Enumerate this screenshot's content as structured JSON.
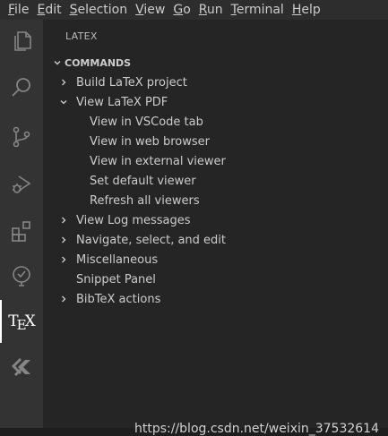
{
  "menubar": {
    "items": [
      {
        "mnemonic": "F",
        "rest": "ile"
      },
      {
        "mnemonic": "E",
        "rest": "dit"
      },
      {
        "mnemonic": "S",
        "rest": "election"
      },
      {
        "mnemonic": "V",
        "rest": "iew"
      },
      {
        "mnemonic": "G",
        "rest": "o"
      },
      {
        "mnemonic": "R",
        "rest": "un"
      },
      {
        "mnemonic": "T",
        "rest": "erminal"
      },
      {
        "mnemonic": "H",
        "rest": "elp"
      }
    ]
  },
  "activitybar": {
    "items": [
      {
        "icon": "files-icon",
        "active": false
      },
      {
        "icon": "search-icon",
        "active": false
      },
      {
        "icon": "source-control-icon",
        "active": false
      },
      {
        "icon": "run-debug-icon",
        "active": false
      },
      {
        "icon": "extensions-icon",
        "active": false
      },
      {
        "icon": "test-icon",
        "active": false
      },
      {
        "icon": "tex-icon",
        "active": true,
        "label_t": "T",
        "label_e": "E",
        "label_x": "X"
      },
      {
        "icon": "remote-icon",
        "active": false
      }
    ]
  },
  "sidebar": {
    "title": "LATEX",
    "section": {
      "label": "COMMANDS",
      "items": [
        {
          "label": "Build LaTeX project",
          "depth": 0,
          "twist": "collapsed"
        },
        {
          "label": "View LaTeX PDF",
          "depth": 0,
          "twist": "expanded"
        },
        {
          "label": "View in VSCode tab",
          "depth": 1,
          "twist": "none"
        },
        {
          "label": "View in web browser",
          "depth": 1,
          "twist": "none"
        },
        {
          "label": "View in external viewer",
          "depth": 1,
          "twist": "none"
        },
        {
          "label": "Set default viewer",
          "depth": 1,
          "twist": "none"
        },
        {
          "label": "Refresh all viewers",
          "depth": 1,
          "twist": "none"
        },
        {
          "label": "View Log messages",
          "depth": 0,
          "twist": "collapsed"
        },
        {
          "label": "Navigate, select, and edit",
          "depth": 0,
          "twist": "collapsed"
        },
        {
          "label": "Miscellaneous",
          "depth": 0,
          "twist": "collapsed"
        },
        {
          "label": "Snippet Panel",
          "depth": 0,
          "twist": "none"
        },
        {
          "label": "BibTeX actions",
          "depth": 0,
          "twist": "collapsed"
        }
      ]
    }
  },
  "watermark": "https://blog.csdn.net/weixin_37532614",
  "colors": {
    "menubar_bg": "#2d2d2d",
    "activitybar_bg": "#333333",
    "sidebar_bg": "#252526",
    "text": "#cccccc",
    "icon_inactive": "#858585",
    "icon_active": "#ffffff"
  }
}
